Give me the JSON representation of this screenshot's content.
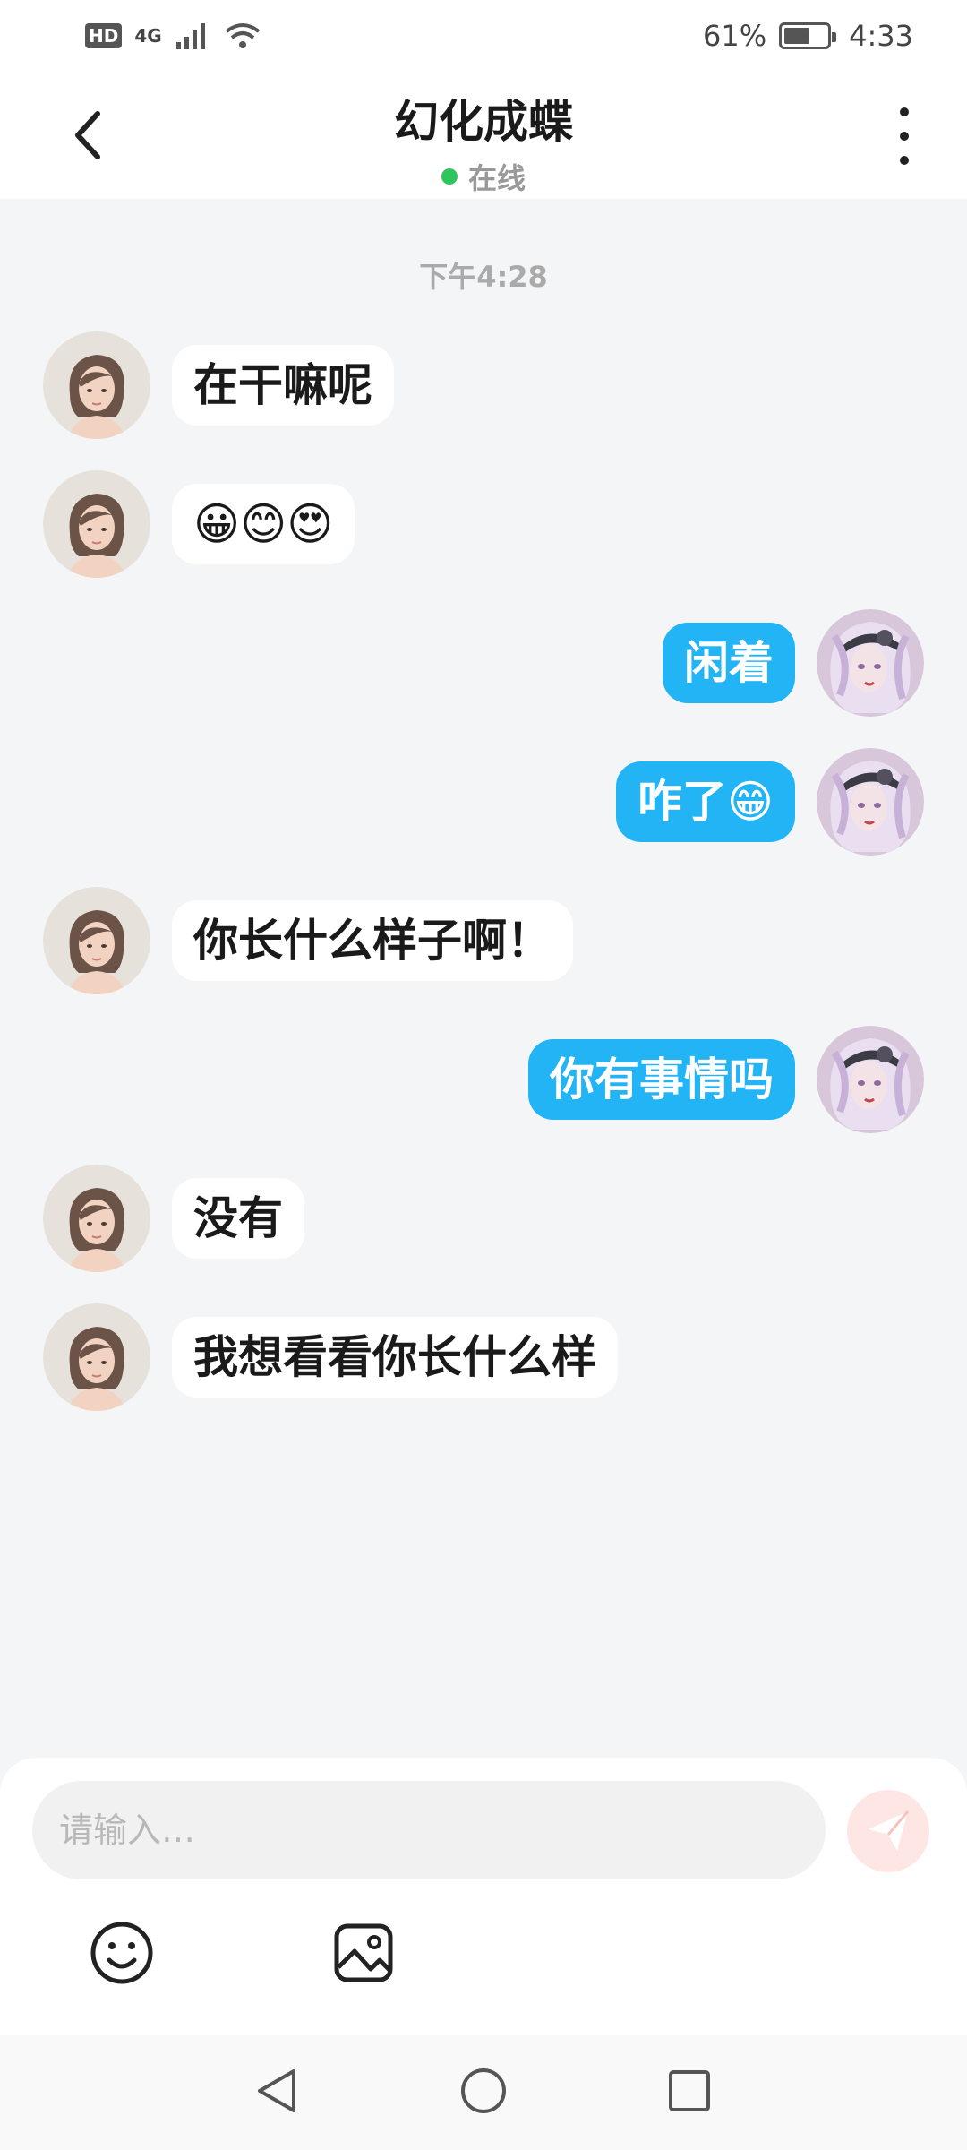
{
  "status_bar": {
    "hd": "HD",
    "network": "4G",
    "battery_percent": "61%",
    "battery_level": 0.61,
    "time": "4:33"
  },
  "header": {
    "title": "幻化成蝶",
    "status": "在线",
    "status_color": "#2fc55d",
    "back_icon": "chevron-left-icon",
    "more_icon": "more-vertical-icon"
  },
  "chat": {
    "timestamp": "下午4:28",
    "messages": [
      {
        "side": "left",
        "text": "在干嘛呢"
      },
      {
        "side": "left",
        "text": "😀😊😍"
      },
      {
        "side": "right",
        "text": "闲着"
      },
      {
        "side": "right",
        "text": "咋了😁"
      },
      {
        "side": "left",
        "text": "你长什么样子啊！"
      },
      {
        "side": "right",
        "text": "你有事情吗"
      },
      {
        "side": "left",
        "text": "没有"
      },
      {
        "side": "left",
        "text": "我想看看你长什么样"
      }
    ]
  },
  "input": {
    "placeholder": "请输入…",
    "send_icon": "send-icon",
    "emoji_icon": "emoji-icon",
    "image_icon": "image-icon"
  },
  "colors": {
    "bubble_self": "#22b4f5",
    "bubble_other": "#ffffff",
    "background": "#f4f5f7"
  }
}
